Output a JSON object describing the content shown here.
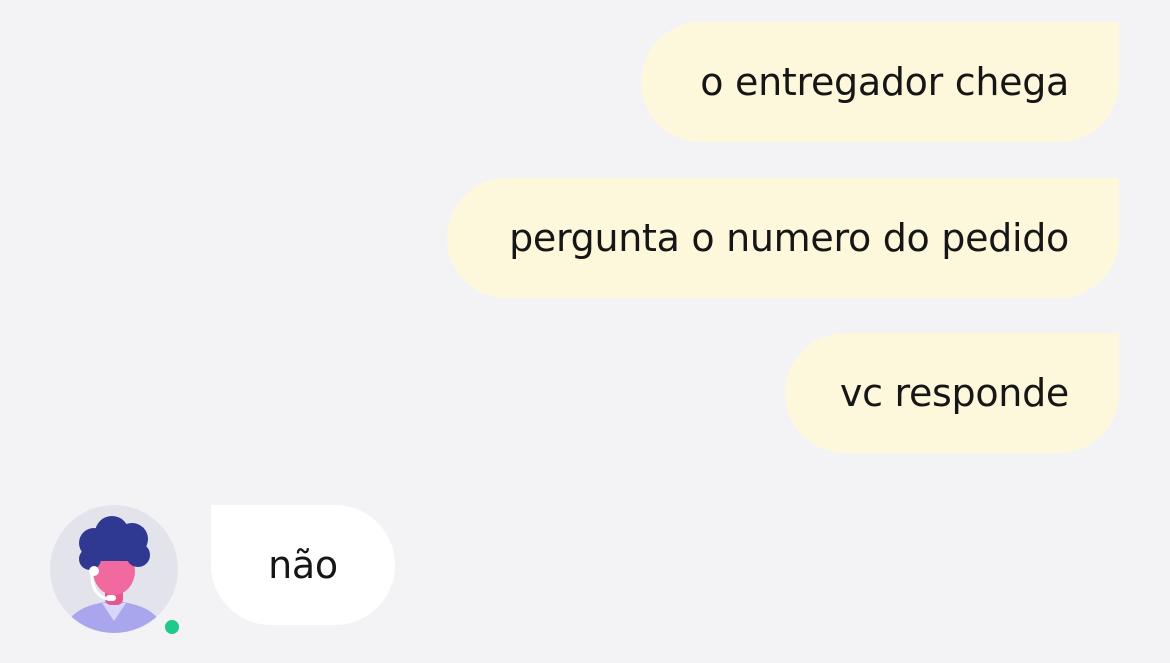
{
  "chat": {
    "messages": [
      {
        "direction": "outgoing",
        "text": "o entregador chega"
      },
      {
        "direction": "outgoing",
        "text": "pergunta o numero do pedido"
      },
      {
        "direction": "outgoing",
        "text": "vc responde"
      },
      {
        "direction": "incoming",
        "text": "não"
      }
    ],
    "agent": {
      "avatar_icon": "support-agent-avatar",
      "status": "online",
      "status_color": "#1fc98a"
    }
  },
  "colors": {
    "background": "#f3f3f6",
    "outgoing_bubble": "#fdf8dc",
    "incoming_bubble": "#ffffff",
    "text": "#161616"
  }
}
